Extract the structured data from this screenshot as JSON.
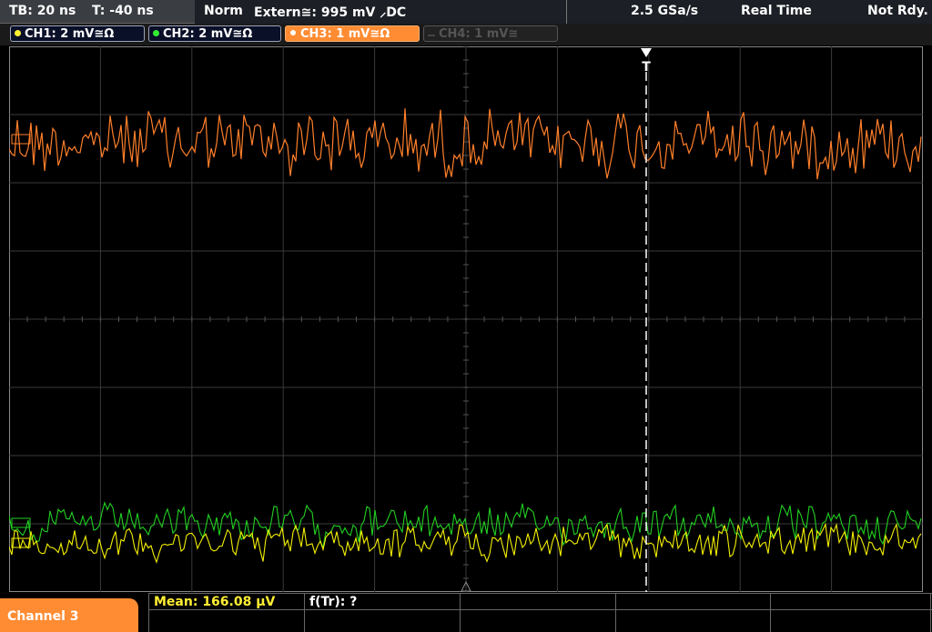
{
  "status": {
    "timebase": "TB: 20 ns",
    "trigger_time": "T: -40 ns",
    "trigger_mode": "Norm",
    "trigger_source": "Extern≅: 995 mV ⸝DC",
    "sample_rate": "2.5 GSa/s",
    "acq_mode": "Real Time",
    "state": "Not Rdy."
  },
  "channels": [
    {
      "label": "CH1: 2 mV≅Ω",
      "color": "#ffee33"
    },
    {
      "label": "CH2: 2 mV≅Ω",
      "color": "#33ee33"
    },
    {
      "label": "CH3: 1 mV≅Ω",
      "color": "#ff8c33"
    },
    {
      "label": "CH4: 1 mV≅",
      "color": "#666666"
    }
  ],
  "trigger_marker": "T",
  "active_channel": "Channel 3",
  "measurements": {
    "mean": "Mean: 166.08 µV",
    "ftr": "f(Tr): ?"
  },
  "colors": {
    "ch1": "#f4f000",
    "ch2": "#22d022",
    "ch3": "#ff7f2a",
    "grid": "#3a3a3a"
  }
}
